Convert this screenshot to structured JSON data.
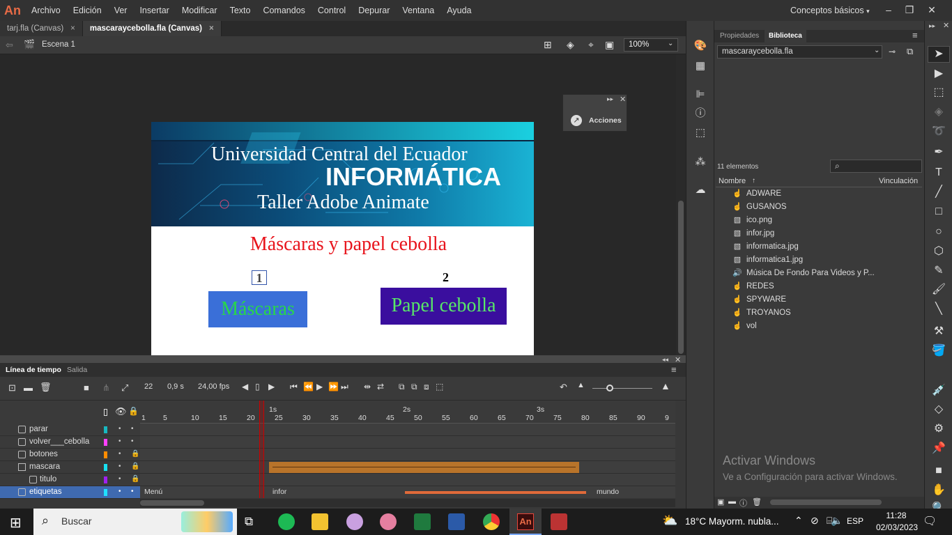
{
  "app": {
    "logo": "An",
    "workspace": "Conceptos básicos"
  },
  "menu": [
    "Archivo",
    "Edición",
    "Ver",
    "Insertar",
    "Modificar",
    "Texto",
    "Comandos",
    "Control",
    "Depurar",
    "Ventana",
    "Ayuda"
  ],
  "tabs": [
    {
      "label": "tarj.fla (Canvas)",
      "close": "×"
    },
    {
      "label": "mascaraycebolla.fla (Canvas)",
      "close": "×"
    }
  ],
  "scene": {
    "label": "Escena 1",
    "zoom": "100%"
  },
  "stage": {
    "university": "Universidad Central del Ecuador",
    "faculty": "INFORMÁTICA",
    "workshop": "Taller Adobe Animate",
    "heading": "Máscaras y papel cebolla",
    "num1": "1",
    "num2": "2",
    "btn_masks": "Máscaras",
    "btn_onion": "Papel cebolla"
  },
  "actions_panel": {
    "label": "Acciones"
  },
  "timeline": {
    "tabs": [
      "Línea de tiempo",
      "Salida"
    ],
    "frame": "22",
    "time": "0,9 s",
    "fps": "24,00 fps",
    "seconds": [
      "1s",
      "2s",
      "3s"
    ],
    "ruler": [
      "1",
      "5",
      "10",
      "15",
      "20",
      "25",
      "30",
      "35",
      "40",
      "45",
      "50",
      "55",
      "60",
      "65",
      "70",
      "75",
      "80",
      "85",
      "90",
      "9"
    ],
    "layers": [
      {
        "name": "parar",
        "color": "#18b8c0"
      },
      {
        "name": "volver___cebolla",
        "color": "#ff40ff"
      },
      {
        "name": "botones",
        "color": "#ff8c00"
      },
      {
        "name": "mascara",
        "color": "#18e0f0"
      },
      {
        "name": "titulo",
        "color": "#a020f0"
      },
      {
        "name": "etiquetas",
        "color": "#20e0ff"
      }
    ],
    "frame_labels": [
      "Menú",
      "infor",
      "mundo"
    ]
  },
  "panels": {
    "tabs": [
      "Propiedades",
      "Biblioteca"
    ],
    "library_file": "mascaraycebolla.fla",
    "count": "11 elementos",
    "col_name": "Nombre",
    "col_link": "Vinculación",
    "items": [
      {
        "name": "ADWARE",
        "icon": "button-symbol-icon"
      },
      {
        "name": "GUSANOS",
        "icon": "button-symbol-icon"
      },
      {
        "name": "ico.png",
        "icon": "bitmap-icon"
      },
      {
        "name": "infor.jpg",
        "icon": "bitmap-icon"
      },
      {
        "name": "informatica.jpg",
        "icon": "bitmap-icon"
      },
      {
        "name": "informatica1.jpg",
        "icon": "bitmap-icon"
      },
      {
        "name": "Música De Fondo Para Videos y P...",
        "icon": "sound-icon"
      },
      {
        "name": "REDES",
        "icon": "button-symbol-icon"
      },
      {
        "name": "SPYWARE",
        "icon": "button-symbol-icon"
      },
      {
        "name": "TROYANOS",
        "icon": "button-symbol-icon"
      },
      {
        "name": "vol",
        "icon": "button-symbol-icon"
      }
    ],
    "activate_title": "Activar Windows",
    "activate_sub": "Ve a Configuración para activar Windows."
  },
  "taskbar": {
    "search": "Buscar",
    "weather": "18°C  Mayorm. nubla...",
    "lang": "ESP",
    "time": "11:28",
    "date": "02/03/2023"
  }
}
